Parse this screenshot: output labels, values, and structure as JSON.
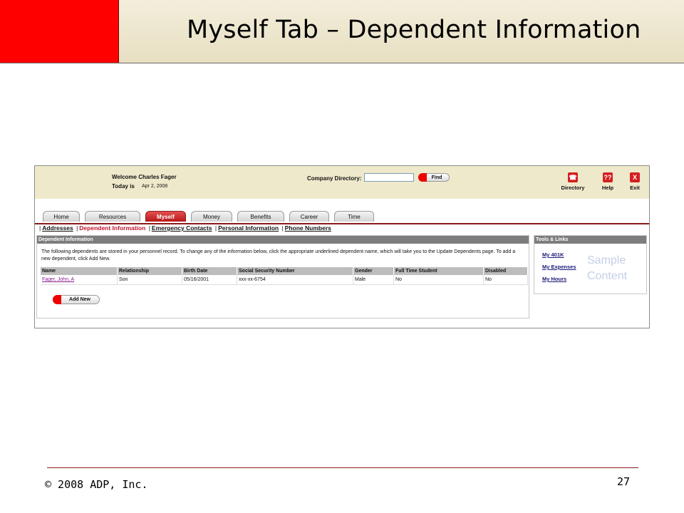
{
  "slide": {
    "title": "Myself Tab – Dependent Information",
    "copyright": "© 2008 ADP, Inc.",
    "page_number": "27",
    "accent_color": "#ff0000"
  },
  "app": {
    "welcome": "Welcome Charles Fager",
    "today_label": "Today is",
    "today_value": "Apr 2, 2008",
    "company_directory_label": "Company Directory:",
    "company_directory_value": "",
    "find_label": "Find",
    "tools": {
      "directory": "Directory",
      "directory_icon": "phone-icon",
      "help": "Help",
      "help_icon": "help-icon",
      "exit": "Exit",
      "exit_icon": "close-icon"
    },
    "tabs": [
      "Home",
      "Resources",
      "Myself",
      "Money",
      "Benefits",
      "Career",
      "Time"
    ],
    "active_tab": "Myself",
    "subnav": [
      "Addresses",
      "Dependent Information",
      "Emergency Contacts",
      "Personal Information",
      "Phone Numbers"
    ],
    "active_subnav": "Dependent Information",
    "dependent_panel": {
      "header": "Dependent Information",
      "intro": "The following dependents are stored in your personnel record. To change any of the information below, click the appropriate underlined dependent name, which will take you to the Update Dependents page. To add a new dependent, click Add New.",
      "columns": [
        "Name",
        "Relationship",
        "Birth Date",
        "Social Security Number",
        "Gender",
        "Full Time Student",
        "Disabled"
      ],
      "rows": [
        [
          "Fager, John, A",
          "Son",
          "05/16/2001",
          "xxx-xx-6754",
          "Male",
          "No",
          "No"
        ]
      ],
      "add_new_label": "Add New"
    },
    "tools_links": {
      "header": "Tools & Links",
      "links": [
        "My 401K",
        "My Expenses",
        "My Hours"
      ],
      "sample_line1": "Sample",
      "sample_line2": "Content"
    }
  }
}
